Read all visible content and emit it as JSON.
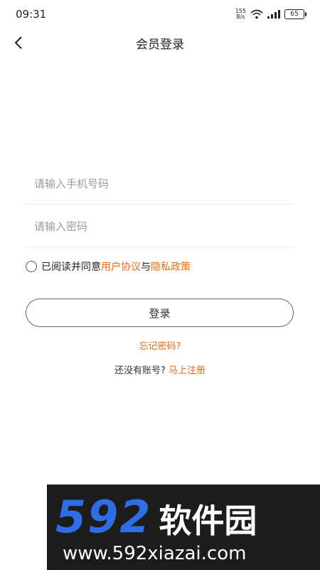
{
  "status_bar": {
    "time": "09:31",
    "speed_value": "155",
    "speed_unit": "B/s",
    "battery": "65"
  },
  "header": {
    "title": "会员登录"
  },
  "form": {
    "phone_placeholder": "请输入手机号码",
    "password_placeholder": "请输入密码"
  },
  "agreement": {
    "prefix": "已阅读并同意",
    "user_agreement": "用户协议",
    "connector": "与",
    "privacy_policy": "隐私政策"
  },
  "login_label": "登录",
  "forgot_password": "忘记密码?",
  "register": {
    "prompt": "还没有账号?",
    "link": "马上注册"
  },
  "watermark": {
    "logo_number": "592",
    "logo_text": "软件园",
    "url": "www.592xiazai.com"
  },
  "colors": {
    "accent": "#e86a12",
    "watermark_bg": "#1c1c1c",
    "watermark_logo": "#2f6de4"
  }
}
